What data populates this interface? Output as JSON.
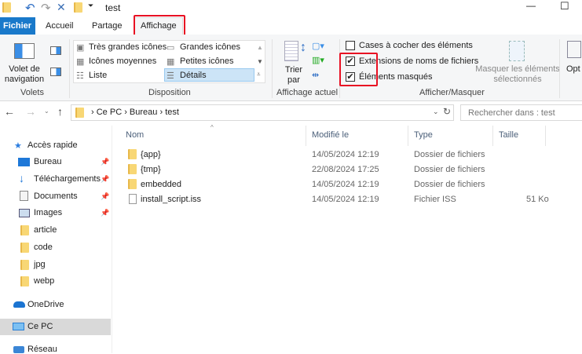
{
  "titlebar": {
    "title": "test",
    "icons": [
      "folder-icon",
      "undo-icon",
      "redo-icon",
      "delete-icon",
      "folder-icon",
      "customize-dropdown-icon"
    ],
    "minimize": "—",
    "maximize": "☐"
  },
  "tabs": [
    {
      "label": "Fichier",
      "active": false
    },
    {
      "label": "Accueil"
    },
    {
      "label": "Partage"
    },
    {
      "label": "Affichage",
      "active": true
    }
  ],
  "ribbon": {
    "volets": {
      "nav_pane": "Volet de navigation",
      "group": "Volets"
    },
    "disposition": {
      "items": [
        "Très grandes icônes",
        "Grandes icônes",
        "Icônes moyennes",
        "Petites icônes",
        "Liste",
        "Détails"
      ],
      "selected": "Détails",
      "group": "Disposition"
    },
    "affichage_actuel": {
      "sort": "Trier par",
      "group": "Affichage actuel"
    },
    "afficher_masquer": {
      "checkboxes": [
        {
          "label": "Cases à cocher des éléments",
          "checked": false
        },
        {
          "label": "Extensions de noms de fichiers",
          "checked": true
        },
        {
          "label": "Éléments masqués",
          "checked": true
        }
      ],
      "hide_selected": "Masquer les éléments sélectionnés",
      "group": "Afficher/Masquer"
    },
    "options": "Opt"
  },
  "address": {
    "path": [
      "Ce PC",
      "Bureau",
      "test"
    ],
    "search_placeholder": "Rechercher dans : test"
  },
  "sidebar": [
    {
      "label": "Accès rapide",
      "icon": "star-icon"
    },
    {
      "label": "Bureau",
      "pinned": true
    },
    {
      "label": "Téléchargements",
      "pinned": true
    },
    {
      "label": "Documents",
      "pinned": true
    },
    {
      "label": "Images",
      "pinned": true
    },
    {
      "label": "article"
    },
    {
      "label": "code"
    },
    {
      "label": "jpg"
    },
    {
      "label": "webp"
    },
    {
      "label": "OneDrive"
    },
    {
      "label": "Ce PC",
      "selected": true
    },
    {
      "label": "Réseau"
    }
  ],
  "columns": [
    "Nom",
    "Modifié le",
    "Type",
    "Taille"
  ],
  "files": [
    {
      "name": "{app}",
      "modified": "14/05/2024 12:19",
      "type": "Dossier de fichiers",
      "size": ""
    },
    {
      "name": "{tmp}",
      "modified": "22/08/2024 17:25",
      "type": "Dossier de fichiers",
      "size": ""
    },
    {
      "name": "embedded",
      "modified": "14/05/2024 12:19",
      "type": "Dossier de fichiers",
      "size": ""
    },
    {
      "name": "install_script.iss",
      "modified": "14/05/2024 12:19",
      "type": "Fichier ISS",
      "size": "51 Ko"
    }
  ]
}
